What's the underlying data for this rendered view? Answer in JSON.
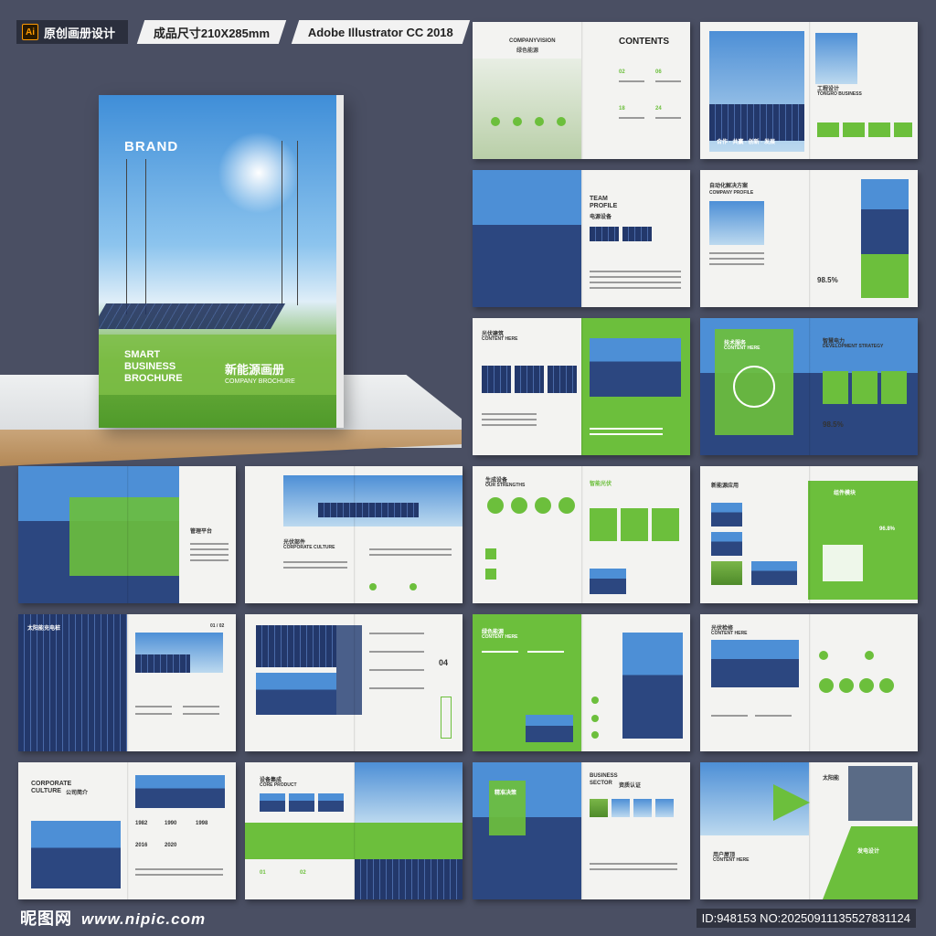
{
  "header": {
    "ai_badge": "Ai",
    "tag1": "原创画册设计",
    "tag2": "成品尺寸210X285mm",
    "tag3": "Adobe Illustrator CC 2018"
  },
  "cover": {
    "brand": "BRAND",
    "left_line1": "SMART",
    "left_line2": "BUSINESS",
    "left_line3": "BROCHURE",
    "title_cn": "新能源画册",
    "subtitle": "COMPANY BROCHURE"
  },
  "spreads": {
    "s1": {
      "left_title": "COMPANYVISION",
      "left_cn": "绿色能源",
      "right_title": "CONTENTS",
      "nums": [
        "02",
        "06",
        "18",
        "24"
      ]
    },
    "s2": {
      "title_cn": "工程设计",
      "title_en": "TONGRO BUSINESS",
      "photo_caption": "合作 · 共赢 · 创新 · 发展"
    },
    "s3": {
      "title1": "TEAM",
      "title2": "PROFILE",
      "cn": "电源设备"
    },
    "s4": {
      "title_cn": "自动化解决方案",
      "title_en": "COMPANY PROFILE",
      "pct": "98.5%"
    },
    "s5": {
      "title_cn": "光伏建筑",
      "title_en": "CONTENT HERE"
    },
    "s6": {
      "title_cn": "技术服务",
      "title_en": "CONTENT HERE",
      "right_cn": "智慧电力",
      "right_en": "DEVELOPMENT STRATEGY",
      "pct": "98.5%"
    },
    "s7": {
      "right_cn": "管理平台"
    },
    "s8": {
      "title_cn": "光伏部件",
      "title_en": "CORPORATE CULTURE"
    },
    "s9": {
      "title_cn": "生成设备",
      "title_en": "OUR STRENGTHS",
      "right_cn": "智能光伏"
    },
    "s10": {
      "title_cn": "新能源应用",
      "right_cn": "组件模块",
      "pct": "96.8%"
    },
    "s11": {
      "title_cn": "太阳能充电桩",
      "page": "01 / 02"
    },
    "s12": {
      "vertical": "04"
    },
    "s13": {
      "title_cn": "绿色能源",
      "title_en": "CONTENT HERE"
    },
    "s14": {
      "title_cn": "光伏检修",
      "title_en": "CONTENT HERE"
    },
    "s15": {
      "title1": "CORPORATE",
      "title2": "CULTURE",
      "title_cn": "公司简介",
      "years": [
        "1982",
        "1990",
        "1998",
        "2016",
        "2020"
      ]
    },
    "s16": {
      "title_cn": "设备集成",
      "title_en": "CORE PRODUCT",
      "n1": "01",
      "n2": "02"
    },
    "s17": {
      "left_cn": "精准决策",
      "title1": "BUSINESS",
      "title2": "SECTOR",
      "title_cn": "资质认证"
    },
    "s18": {
      "title_cn": "太阳能",
      "sub_cn": "用户屋顶",
      "sub_en": "CONTENT HERE",
      "btn": "发电设计"
    }
  },
  "footer": {
    "watermark": "昵图网",
    "url": "www.nipic.com",
    "id": "ID:948153 NO:20250911135527831124"
  }
}
